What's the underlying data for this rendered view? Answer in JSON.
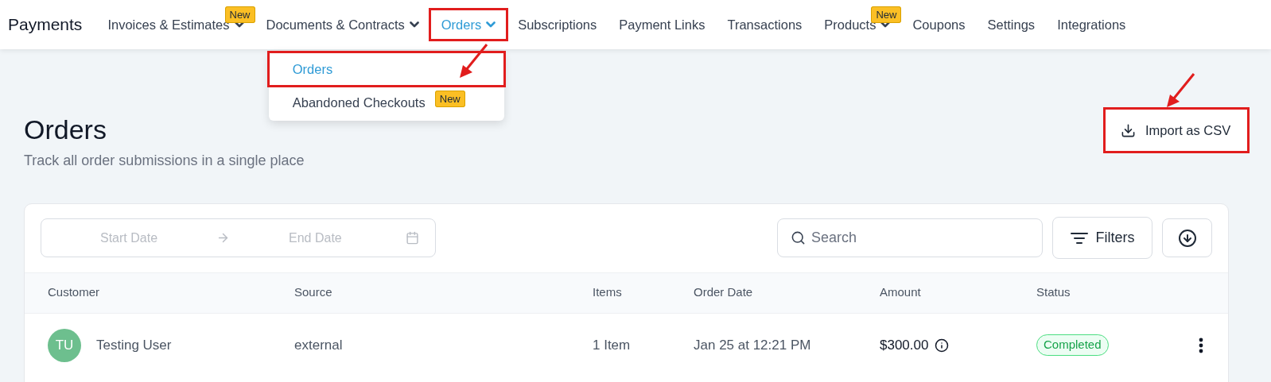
{
  "app_title": "Payments",
  "nav": [
    {
      "label": "Invoices & Estimates",
      "has_menu": true,
      "badge": "New",
      "selected": false,
      "highlighted": false
    },
    {
      "label": "Documents & Contracts",
      "has_menu": true,
      "selected": false,
      "highlighted": false
    },
    {
      "label": "Orders",
      "has_menu": true,
      "selected": true,
      "highlighted": true,
      "menu": [
        {
          "label": "Orders",
          "selected": true,
          "highlighted": true,
          "arrow": true
        },
        {
          "label": "Abandoned Checkouts",
          "badge": "New",
          "selected": false,
          "highlighted": false,
          "arrow": false
        }
      ]
    },
    {
      "label": "Subscriptions",
      "has_menu": false,
      "selected": false,
      "highlighted": false
    },
    {
      "label": "Payment Links",
      "has_menu": false,
      "selected": false,
      "highlighted": false
    },
    {
      "label": "Transactions",
      "has_menu": false,
      "selected": false,
      "highlighted": false
    },
    {
      "label": "Products",
      "has_menu": true,
      "badge": "New",
      "selected": false,
      "highlighted": false
    },
    {
      "label": "Coupons",
      "has_menu": false,
      "selected": false,
      "highlighted": false
    },
    {
      "label": "Settings",
      "has_menu": false,
      "selected": false,
      "highlighted": false
    },
    {
      "label": "Integrations",
      "has_menu": false,
      "selected": false,
      "highlighted": false
    }
  ],
  "page": {
    "title": "Orders",
    "subtitle": "Track all order submissions in a single place"
  },
  "import_button": {
    "label": "Import as CSV",
    "highlighted": true,
    "arrow": true
  },
  "filters": {
    "start_placeholder": "Start Date",
    "end_placeholder": "End Date",
    "search_placeholder": "Search",
    "filters_button": "Filters"
  },
  "table": {
    "columns": [
      "Customer",
      "Source",
      "Items",
      "Order Date",
      "Amount",
      "Status"
    ],
    "rows": [
      {
        "initials": "TU",
        "color": "#6dbf8e",
        "customer": "Testing User",
        "source": "external",
        "items": "1 Item",
        "order_date": "Jan 25 at 12:21 PM",
        "amount": "$300.00",
        "status": "Completed"
      }
    ]
  }
}
